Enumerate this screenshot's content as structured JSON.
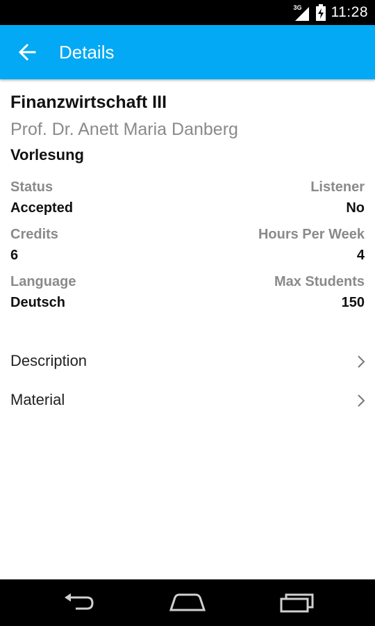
{
  "status_bar": {
    "network_type": "3G",
    "time": "11:28",
    "icons": [
      "signal-icon",
      "battery-icon"
    ]
  },
  "app_bar": {
    "title": "Details",
    "back_icon": "arrow-back-icon",
    "color": "#03a9f4"
  },
  "course": {
    "title": "Finanzwirtschaft III",
    "lecturer": "Prof. Dr. Anett Maria Danberg",
    "type": "Vorlesung"
  },
  "info": [
    {
      "left_label": "Status",
      "left_value": "Accepted",
      "right_label": "Listener",
      "right_value": "No"
    },
    {
      "left_label": "Credits",
      "left_value": "6",
      "right_label": "Hours Per Week",
      "right_value": "4"
    },
    {
      "left_label": "Language",
      "left_value": "Deutsch",
      "right_label": "Max Students",
      "right_value": "150"
    }
  ],
  "nav_items": [
    {
      "label": "Description",
      "icon": "chevron-right-icon"
    },
    {
      "label": "Material",
      "icon": "chevron-right-icon"
    }
  ],
  "system_nav": {
    "icons": [
      "back-icon",
      "home-icon",
      "recents-icon"
    ]
  }
}
